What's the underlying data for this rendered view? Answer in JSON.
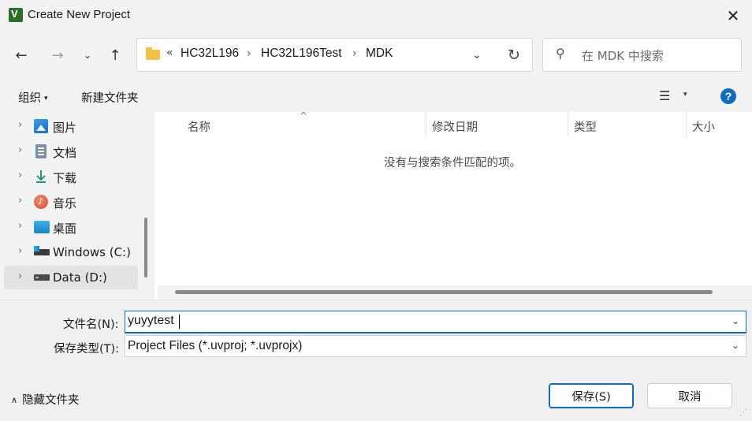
{
  "window": {
    "title": "Create New Project",
    "close_glyph": "✕"
  },
  "nav": {
    "back_glyph": "←",
    "forward_glyph": "→",
    "recent_glyph": "⌄",
    "up_glyph": "↑",
    "breadcrumb_overflow": "«",
    "breadcrumbs": [
      "HC32L196",
      "HC32L196Test",
      "MDK"
    ],
    "breadcrumb_sep": "›",
    "dropdown_glyph": "⌄",
    "refresh_glyph": "↻",
    "search_placeholder": "在 MDK 中搜索",
    "search_glyph": "⚲"
  },
  "toolbar": {
    "organize_label": "组织",
    "organize_caret": "▾",
    "new_folder_label": "新建文件夹",
    "view_glyph": "☰",
    "view_caret": "▾",
    "help_label": "?"
  },
  "sidebar": {
    "items": [
      {
        "label": "图片",
        "icon": "pictures-icon"
      },
      {
        "label": "文档",
        "icon": "documents-icon"
      },
      {
        "label": "下载",
        "icon": "downloads-icon"
      },
      {
        "label": "音乐",
        "icon": "music-icon"
      },
      {
        "label": "桌面",
        "icon": "desktop-icon"
      },
      {
        "label": "Windows (C:)",
        "icon": "drive-icon"
      },
      {
        "label": "Data (D:)",
        "icon": "drive-icon",
        "selected": true
      }
    ],
    "chevron": "›"
  },
  "filelist": {
    "sort_glyph": "^",
    "columns": [
      "名称",
      "修改日期",
      "类型",
      "大小"
    ],
    "empty_message": "没有与搜索条件匹配的项。"
  },
  "form": {
    "filename_label": "文件名(N):",
    "filename_value": "yuyytest",
    "filetype_label": "保存类型(T):",
    "filetype_value": "Project Files (*.uvproj; *.uvprojx)",
    "dropdown_glyph": "⌄"
  },
  "footer": {
    "hide_folders_glyph": "∧",
    "hide_folders_label": "隐藏文件夹",
    "save_label": "保存(S)",
    "cancel_label": "取消",
    "grip_glyph": "⋰"
  },
  "colors": {
    "accent": "#0f6cbd",
    "folder": "#f2c246"
  }
}
